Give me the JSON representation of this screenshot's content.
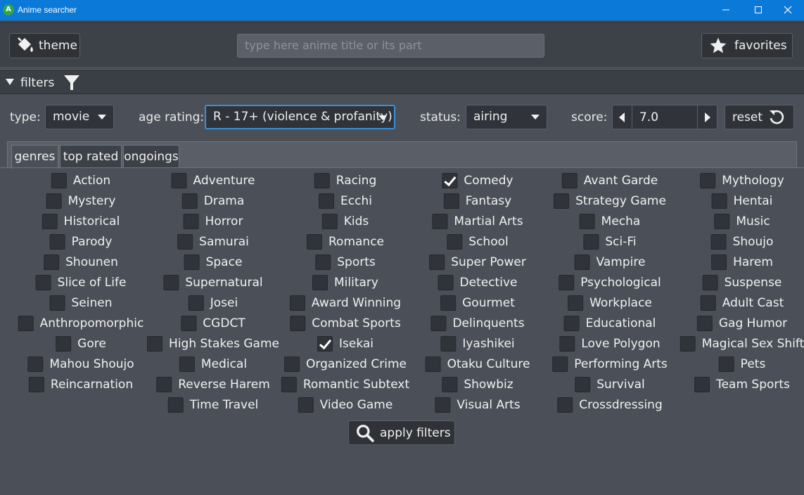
{
  "window": {
    "title": "Anime searcher",
    "icon_letter": "A"
  },
  "header": {
    "theme_label": "theme",
    "search_placeholder": "type here anime title or its part",
    "favorites_label": "favorites"
  },
  "filters": {
    "toggle_label": "filters",
    "type_label": "type:",
    "type_value": "movie",
    "age_label": "age rating:",
    "age_value": "R - 17+ (violence & profanity)",
    "status_label": "status:",
    "status_value": "airing",
    "score_label": "score:",
    "score_value": "7.0",
    "reset_label": "reset"
  },
  "tabs": [
    {
      "label": "genres",
      "active": true
    },
    {
      "label": "top rated",
      "active": false
    },
    {
      "label": "ongoings",
      "active": false
    }
  ],
  "genres": [
    [
      "Action",
      "Adventure",
      "Racing",
      "Comedy",
      "Avant Garde",
      "Mythology"
    ],
    [
      "Mystery",
      "Drama",
      "Ecchi",
      "Fantasy",
      "Strategy Game",
      "Hentai"
    ],
    [
      "Historical",
      "Horror",
      "Kids",
      "Martial Arts",
      "Mecha",
      "Music"
    ],
    [
      "Parody",
      "Samurai",
      "Romance",
      "School",
      "Sci-Fi",
      "Shoujo"
    ],
    [
      "Shounen",
      "Space",
      "Sports",
      "Super Power",
      "Vampire",
      "Harem"
    ],
    [
      "Slice of Life",
      "Supernatural",
      "Military",
      "Detective",
      "Psychological",
      "Suspense"
    ],
    [
      "Seinen",
      "Josei",
      "Award Winning",
      "Gourmet",
      "Workplace",
      "Adult Cast"
    ],
    [
      "Anthropomorphic",
      "CGDCT",
      "Combat Sports",
      "Delinquents",
      "Educational",
      "Gag Humor"
    ],
    [
      "Gore",
      "High Stakes Game",
      "Isekai",
      "Iyashikei",
      "Love Polygon",
      "Magical Sex Shift"
    ],
    [
      "Mahou Shoujo",
      "Medical",
      "Organized Crime",
      "Otaku Culture",
      "Performing Arts",
      "Pets"
    ],
    [
      "Reincarnation",
      "Reverse Harem",
      "Romantic Subtext",
      "Showbiz",
      "Survival",
      "Team Sports"
    ],
    [
      "",
      "Time Travel",
      "Video Game",
      "Visual Arts",
      "Crossdressing",
      ""
    ]
  ],
  "checked_genres": [
    "Comedy",
    "Isekai"
  ],
  "apply_label": "apply filters",
  "colors": {
    "titlebar": "#0a79d8",
    "background": "#4b5058",
    "focus": "#3a8fd8"
  }
}
